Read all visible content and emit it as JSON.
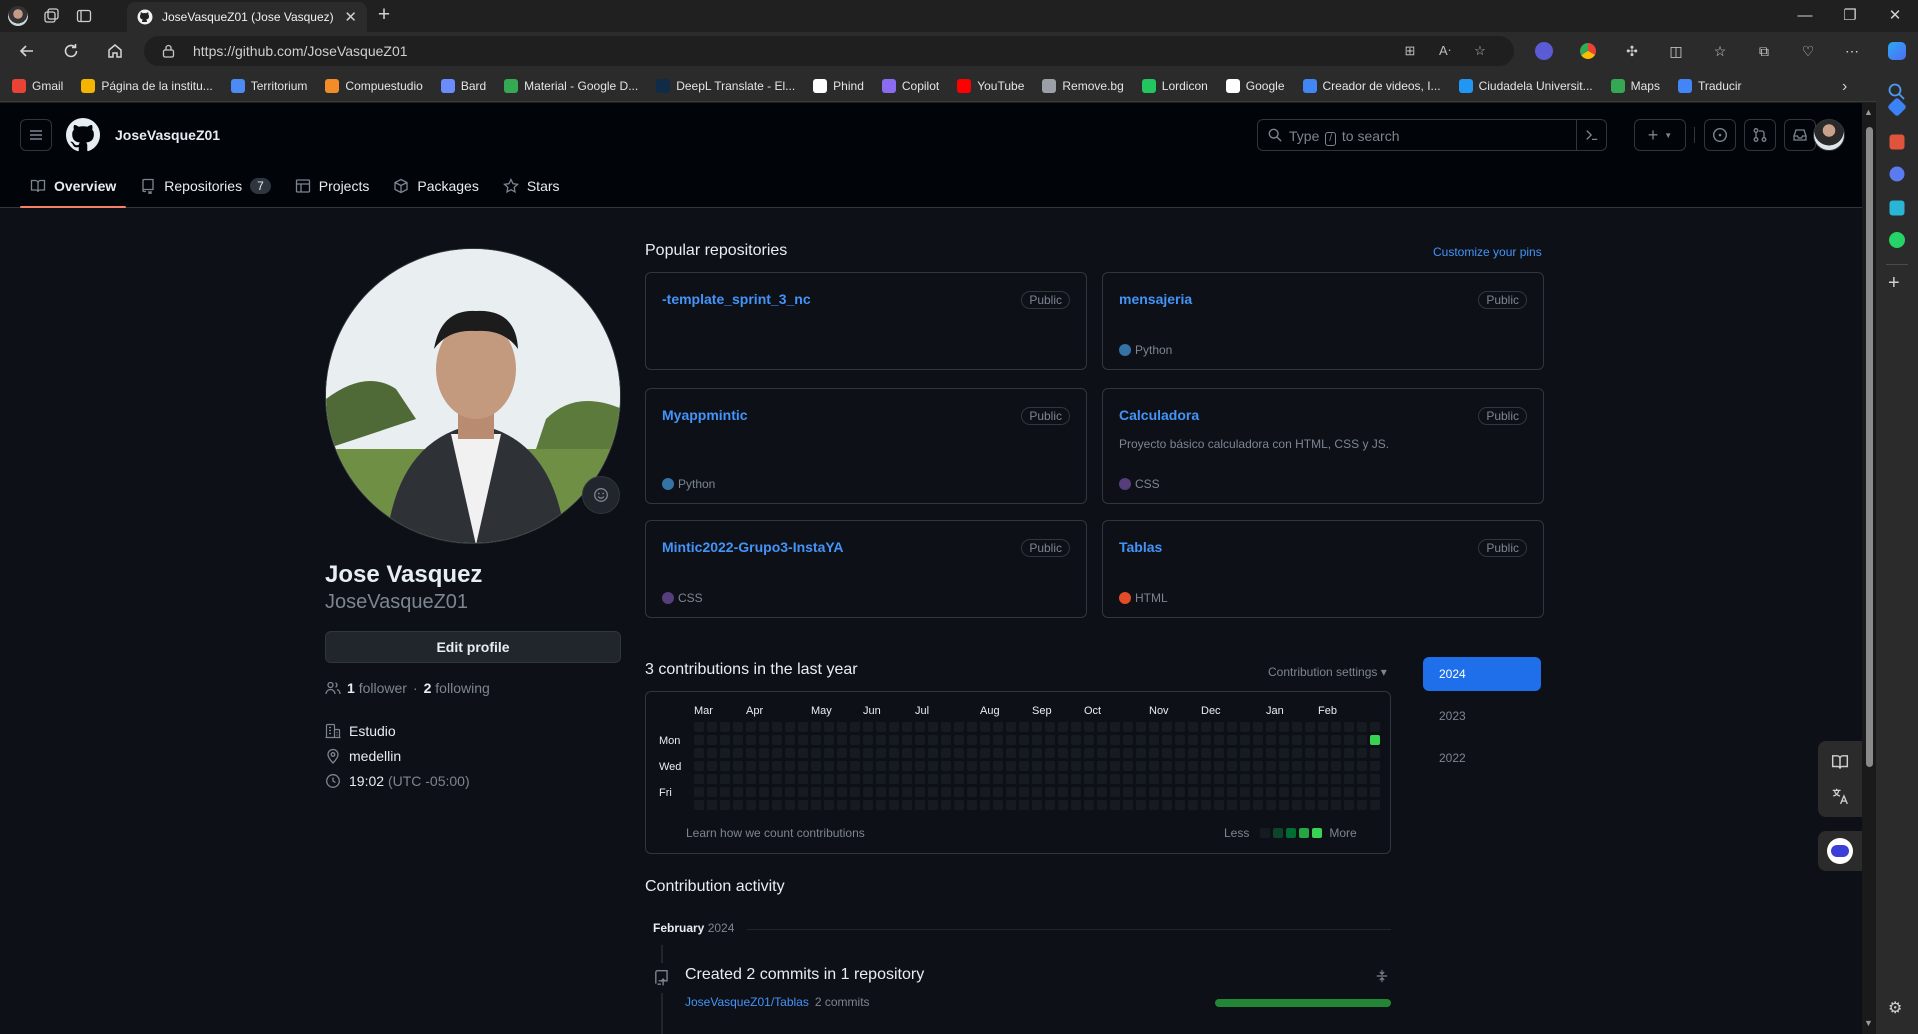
{
  "browser": {
    "tab_title": "JoseVasqueZ01 (Jose Vasquez)",
    "url": "https://github.com/JoseVasqueZ01",
    "bookmarks": [
      {
        "label": "Gmail",
        "color": "#ea4335"
      },
      {
        "label": "Página de la institu...",
        "color": "#f4b400"
      },
      {
        "label": "Territorium",
        "color": "#4c8bf5"
      },
      {
        "label": "Compuestudio",
        "color": "#f28c28"
      },
      {
        "label": "Bard",
        "color": "#6b8cff"
      },
      {
        "label": "Material - Google D...",
        "color": "#34a853"
      },
      {
        "label": "DeepL Translate - El...",
        "color": "#0f2b46"
      },
      {
        "label": "Phind",
        "color": "#ffffff"
      },
      {
        "label": "Copilot",
        "color": "#8a6cf0"
      },
      {
        "label": "YouTube",
        "color": "#ff0000"
      },
      {
        "label": "Remove.bg",
        "color": "#9aa0a6"
      },
      {
        "label": "Lordicon",
        "color": "#22c55e"
      },
      {
        "label": "Google",
        "color": "#ffffff"
      },
      {
        "label": "Creador de videos, I...",
        "color": "#4285f4"
      },
      {
        "label": "Ciudadela Universit...",
        "color": "#2196f3"
      },
      {
        "label": "Maps",
        "color": "#34a853"
      },
      {
        "label": "Traducir",
        "color": "#4285f4"
      }
    ]
  },
  "header": {
    "username": "JoseVasqueZ01",
    "search_prefix": "Type",
    "search_key": "/",
    "search_suffix": "to search"
  },
  "tabs": [
    {
      "label": "Overview",
      "icon": "book-icon"
    },
    {
      "label": "Repositories",
      "icon": "repo-icon",
      "count": "7"
    },
    {
      "label": "Projects",
      "icon": "table-icon"
    },
    {
      "label": "Packages",
      "icon": "package-icon"
    },
    {
      "label": "Stars",
      "icon": "star-icon"
    }
  ],
  "profile": {
    "full_name": "Jose Vasquez",
    "login": "JoseVasqueZ01",
    "edit_label": "Edit profile",
    "followers_count": "1",
    "followers_label": "follower",
    "separator": "·",
    "following_count": "2",
    "following_label": "following",
    "company": "Estudio",
    "location": "medellin",
    "time": "19:02",
    "timezone": "(UTC -05:00)"
  },
  "popular": {
    "title": "Popular repositories",
    "customize_label": "Customize your pins",
    "repos": [
      {
        "name": "-template_sprint_3_nc",
        "badge": "Public",
        "description": "",
        "language": "",
        "lang_color": ""
      },
      {
        "name": "mensajeria",
        "badge": "Public",
        "description": "",
        "language": "Python",
        "lang_color": "#3572a5"
      },
      {
        "name": "Myappmintic",
        "badge": "Public",
        "description": "",
        "language": "Python",
        "lang_color": "#3572a5"
      },
      {
        "name": "Calculadora",
        "badge": "Public",
        "description": "Proyecto básico calculadora con HTML, CSS y JS.",
        "language": "CSS",
        "lang_color": "#563d7c"
      },
      {
        "name": "Mintic2022-Grupo3-InstaYA",
        "badge": "Public",
        "description": "",
        "language": "CSS",
        "lang_color": "#563d7c"
      },
      {
        "name": "Tablas",
        "badge": "Public",
        "description": "",
        "language": "HTML",
        "lang_color": "#e34c26"
      }
    ]
  },
  "contributions": {
    "title": "3 contributions in the last year",
    "settings_label": "Contribution settings ▾",
    "months": [
      "Mar",
      "Apr",
      "May",
      "Jun",
      "Jul",
      "Aug",
      "Sep",
      "Oct",
      "Nov",
      "Dec",
      "Jan",
      "Feb"
    ],
    "days": [
      "Mon",
      "Wed",
      "Fri"
    ],
    "learn_label": "Learn how we count contributions",
    "less_label": "Less",
    "more_label": "More",
    "empty_color": "#161b22",
    "level_colors": [
      "#161b22",
      "#0e4429",
      "#006d32",
      "#26a641",
      "#39d353"
    ],
    "active_cells": [
      {
        "week": 52,
        "day": 1,
        "level": 4
      }
    ],
    "years": [
      "2024",
      "2023",
      "2022"
    ],
    "selected_year": "2024"
  },
  "activity": {
    "title": "Contribution activity",
    "month": "February",
    "year": "2024",
    "summary": "Created 2 commits in 1 repository",
    "repo": "JoseVasqueZ01/Tablas",
    "repo_commits": "2 commits",
    "bar_share": 1.0
  }
}
